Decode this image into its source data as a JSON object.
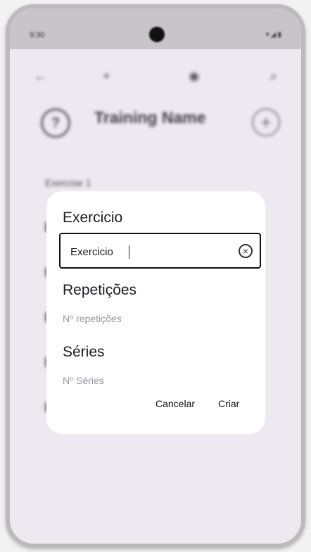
{
  "status_bar": {
    "time": "9:30"
  },
  "header": {
    "title": "Training Name",
    "help_glyph": "?",
    "add_glyph": "+"
  },
  "list": {
    "first_item": "Exercise 1"
  },
  "dialog": {
    "exercise_heading": "Exercicio",
    "exercise_value": "Exercicio",
    "reps_heading": "Repetições",
    "reps_placeholder": "Nº repetições",
    "sets_heading": "Séries",
    "sets_placeholder": "Nº Séries",
    "cancel_label": "Cancelar",
    "create_label": "Criar"
  },
  "icons": {
    "back": "back-arrow-icon",
    "add": "plus-icon",
    "account": "account-icon",
    "search": "search-icon",
    "help": "help-circle-icon",
    "add_circle": "add-circle-icon",
    "clear": "clear-circle-icon"
  }
}
